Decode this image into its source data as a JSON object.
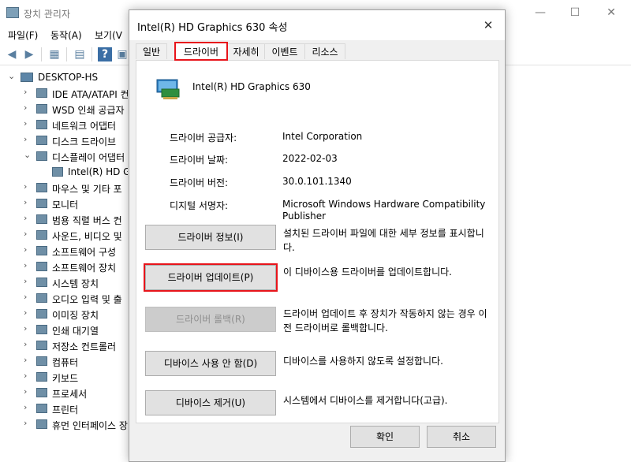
{
  "device_manager": {
    "title": "장치 관리자",
    "window_buttons": [
      "—",
      "☐",
      "✕"
    ],
    "menu": [
      "파일(F)",
      "동작(A)",
      "보기(V"
    ],
    "toolbar_icons": [
      "back-arrow-icon",
      "forward-arrow-icon",
      "properties-icon",
      "driver-icon",
      "help-icon",
      "view-icon"
    ],
    "tree": {
      "root": "DESKTOP-HS",
      "items": [
        {
          "label": "IDE ATA/ATAPI 컨",
          "expanded": false
        },
        {
          "label": "WSD 인쇄 공급자",
          "expanded": false
        },
        {
          "label": "네트워크 어댑터",
          "expanded": false
        },
        {
          "label": "디스크 드라이브",
          "expanded": false
        },
        {
          "label": "디스플레이 어댑터",
          "expanded": true
        },
        {
          "label": "Intel(R) HD Grap",
          "child": true
        },
        {
          "label": "마우스 및 기타 포",
          "expanded": false
        },
        {
          "label": "모니터",
          "expanded": false
        },
        {
          "label": "범용 직렬 버스 컨",
          "expanded": false
        },
        {
          "label": "사운드, 비디오 및",
          "expanded": false
        },
        {
          "label": "소프트웨어 구성",
          "expanded": false
        },
        {
          "label": "소프트웨어 장치",
          "expanded": false
        },
        {
          "label": "시스템 장치",
          "expanded": false
        },
        {
          "label": "오디오 입력 및 출",
          "expanded": false
        },
        {
          "label": "이미징 장치",
          "expanded": false
        },
        {
          "label": "인쇄 대기열",
          "expanded": false
        },
        {
          "label": "저장소 컨트롤러",
          "expanded": false
        },
        {
          "label": "컴퓨터",
          "expanded": false
        },
        {
          "label": "키보드",
          "expanded": false
        },
        {
          "label": "프로세서",
          "expanded": false
        },
        {
          "label": "프린터",
          "expanded": false
        },
        {
          "label": "휴먼 인터페이스 장",
          "expanded": false
        }
      ]
    }
  },
  "dialog": {
    "title": "Intel(R) HD Graphics 630 속성",
    "close": "✕",
    "tabs": [
      {
        "label": "일반",
        "active": false
      },
      {
        "label": "드라이버",
        "active": true
      },
      {
        "label": "자세히",
        "active": false
      },
      {
        "label": "이벤트",
        "active": false
      },
      {
        "label": "리소스",
        "active": false
      }
    ],
    "device_name": "Intel(R) HD Graphics 630",
    "properties": [
      {
        "label": "드라이버 공급자:",
        "value": "Intel Corporation"
      },
      {
        "label": "드라이버 날짜:",
        "value": "2022-02-03"
      },
      {
        "label": "드라이버 버전:",
        "value": "30.0.101.1340"
      },
      {
        "label": "디지털 서명자:",
        "value": "Microsoft Windows Hardware Compatibility Publisher"
      }
    ],
    "actions": [
      {
        "button": "드라이버 정보(I)",
        "description": "설치된 드라이버 파일에 대한 세부 정보를 표시합니다.",
        "enabled": true
      },
      {
        "button": "드라이버 업데이트(P)",
        "description": "이 디바이스용 드라이버를 업데이트합니다.",
        "enabled": true,
        "highlighted": true
      },
      {
        "button": "드라이버 롤백(R)",
        "description": "드라이버 업데이트 후 장치가 작동하지 않는 경우 이전 드라이버로 롤백합니다.",
        "enabled": false
      },
      {
        "button": "디바이스 사용 안 함(D)",
        "description": "디바이스를 사용하지 않도록 설정합니다.",
        "enabled": true
      },
      {
        "button": "디바이스 제거(U)",
        "description": "시스템에서 디바이스를 제거합니다(고급).",
        "enabled": true
      }
    ],
    "ok": "확인",
    "cancel": "취소"
  }
}
